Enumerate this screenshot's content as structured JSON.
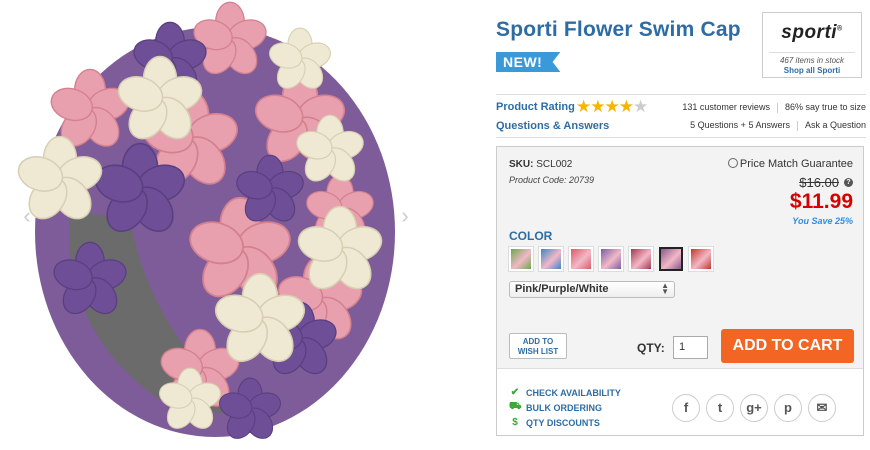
{
  "product": {
    "title": "Sporti Flower Swim Cap",
    "badge": "NEW!"
  },
  "brand": {
    "logo": "sporti",
    "logo_mark": "®",
    "stock": "467 items in stock",
    "shop_link": "Shop all Sporti"
  },
  "rating": {
    "label": "Product Rating",
    "stars_filled": 4,
    "stars_total": 5,
    "reviews": "131 customer reviews",
    "size_note": "86% say true to size",
    "qa_label": "Questions & Answers",
    "qa_count": "5 Questions + 5 Answers",
    "ask_link": "Ask a Question"
  },
  "purchase": {
    "sku_label": "SKU:",
    "sku": "SCL002",
    "product_code": "Product Code: 20739",
    "price_match": "Price Match Guarantee",
    "old_price": "$16.00",
    "info_icon": "?",
    "price": "$11.99",
    "save": "You Save 25%",
    "color_label": "COLOR",
    "swatches": [
      {
        "icon": "swatch-multicolor",
        "color": "#6aa84f",
        "selected": false
      },
      {
        "icon": "swatch-blue",
        "color": "#3d85c6",
        "selected": false
      },
      {
        "icon": "swatch-red",
        "color": "#d95b6b",
        "selected": false
      },
      {
        "icon": "swatch-purple",
        "color": "#7b5ea7",
        "selected": false
      },
      {
        "icon": "swatch-pink-dark",
        "color": "#a33a52",
        "selected": false
      },
      {
        "icon": "swatch-pink-purple-white",
        "color": "#8a5a8f",
        "selected": true
      },
      {
        "icon": "swatch-red-green",
        "color": "#c0392b",
        "selected": false
      }
    ],
    "selected_color": "Pink/Purple/White",
    "wish_line1": "ADD TO",
    "wish_line2": "WISH LIST",
    "qty_label": "QTY:",
    "qty_value": "1",
    "add_to_cart": "ADD TO CART",
    "links": [
      {
        "icon": "check-icon",
        "glyph": "✔",
        "label": "CHECK AVAILABILITY"
      },
      {
        "icon": "truck-icon",
        "glyph": "⛟",
        "label": "BULK ORDERING"
      },
      {
        "icon": "dollar-icon",
        "glyph": "$",
        "label": "QTY DISCOUNTS"
      }
    ],
    "socials": [
      {
        "icon": "facebook-icon",
        "glyph": "f"
      },
      {
        "icon": "twitter-icon",
        "glyph": "t"
      },
      {
        "icon": "google-plus-icon",
        "glyph": "g+"
      },
      {
        "icon": "pinterest-icon",
        "glyph": "p"
      },
      {
        "icon": "email-icon",
        "glyph": "✉"
      }
    ]
  },
  "colors": {
    "title_blue": "#2e6da4",
    "badge_blue": "#3a9ad9",
    "price_red": "#d60000",
    "cart_orange": "#f26522",
    "star_gold": "#f5b500"
  }
}
